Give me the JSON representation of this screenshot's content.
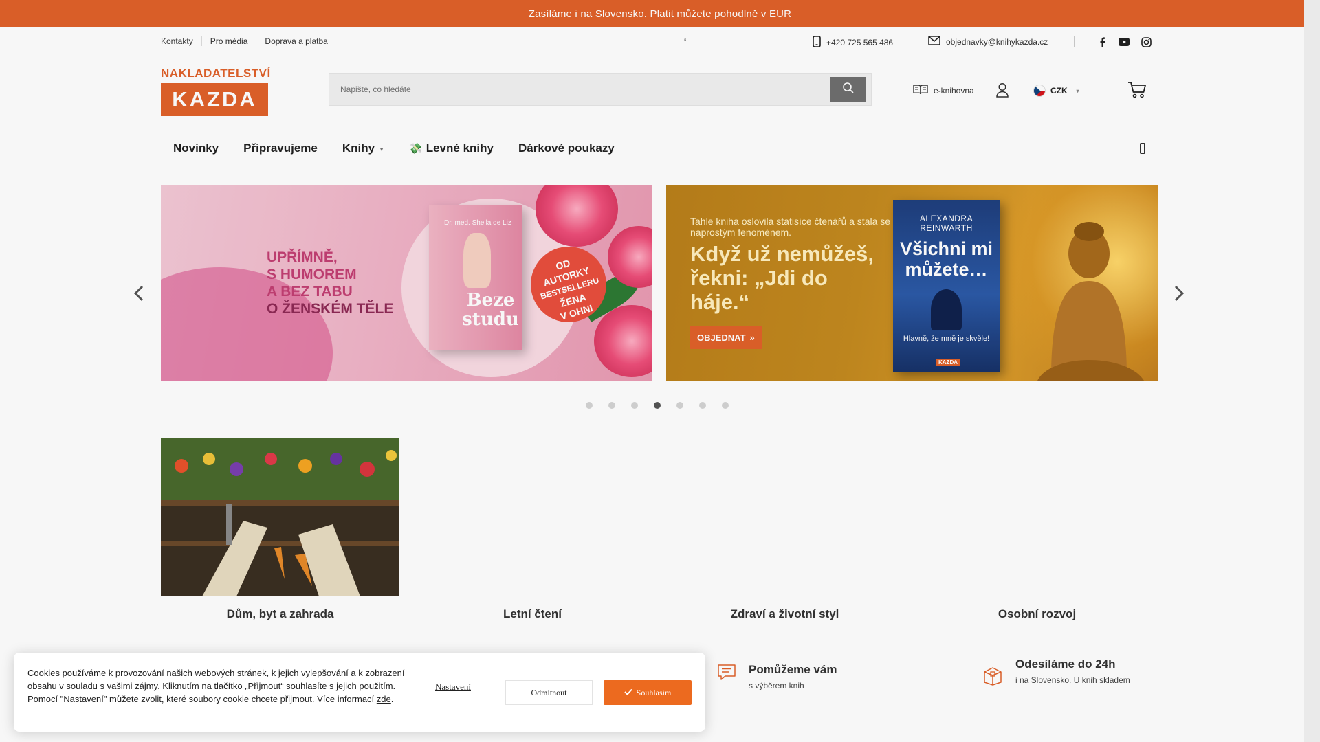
{
  "promo": {
    "text": "Zasíláme i na Slovensko. Platit můžete pohodlně v EUR"
  },
  "util": {
    "links": [
      "Kontakty",
      "Pro média",
      "Doprava a platba"
    ],
    "dot": "▫",
    "phone": "+420 725 565 486",
    "email": "objednavky@knihykazda.cz",
    "social": [
      "facebook-icon",
      "youtube-icon",
      "instagram-icon"
    ]
  },
  "header": {
    "logo_top": "NAKLADATELSTVÍ",
    "logo_main": "KAZDA",
    "search_placeholder": "Napište, co hledáte",
    "ebook_label": "e-knihovna",
    "currency": "CZK"
  },
  "nav": {
    "items": [
      "Novinky",
      "Připravujeme",
      "Knihy",
      "Levné knihy",
      "Dárkové poukazy"
    ],
    "levne_emoji": "💸"
  },
  "carousel": {
    "slide1": {
      "lines": [
        "UPŘÍMNĚ,",
        "S HUMOREM",
        "A BEZ TABU",
        "O ŽENSKÉM TĚLE"
      ],
      "book_author": "Dr. med. Sheila de Liz",
      "book_title": "Beze studu",
      "badge": [
        "OD",
        "AUTORKY",
        "BESTSELLERU",
        "ŽENA",
        "V OHNI"
      ]
    },
    "slide2": {
      "lead": "Tahle kniha oslovila statisíce čtenářů a stala se naprostým fenoménem.",
      "headline": "Když už nemůžeš, řekni: „Jdi do háje.“",
      "cta": "OBJEDNAT",
      "cta_arrow": "»",
      "book_author": "ALEXANDRA REINWARTH",
      "book_title": "Všichni mi můžete…",
      "book_sub": "Hlavně, že mně je skvěle!",
      "book_publisher": "KAZDA"
    },
    "dots": 7,
    "active_dot": 3
  },
  "categories": [
    "Dům, byt a zahrada",
    "Letní čtení",
    "Zdraví a životní styl",
    "Osobní rozvoj"
  ],
  "benefits": [
    {
      "title": "Pomůžeme vám",
      "desc": "s výběrem knih",
      "icon": "chat-icon"
    },
    {
      "title": "Odesíláme do 24h",
      "desc": "i na Slovensko. U knih skladem",
      "icon": "box-icon"
    }
  ],
  "cookie": {
    "text": "Cookies používáme k provozování našich webových stránek, k jejich vylepšování a k zobrazení obsahu v souladu s vašimi zájmy. Kliknutím na tlačítko „Přijmout“ souhlasíte s jejich použitím. Pomocí \"Nastavení\" můžete zvolit, které soubory cookie chcete přijmout. Více informací",
    "link": "zde",
    "settings": "Nastavení",
    "decline": "Odmítnout",
    "accept": "Souhlasím"
  },
  "colors": {
    "brand": "#e0622a",
    "accept": "#ec6a1f"
  }
}
